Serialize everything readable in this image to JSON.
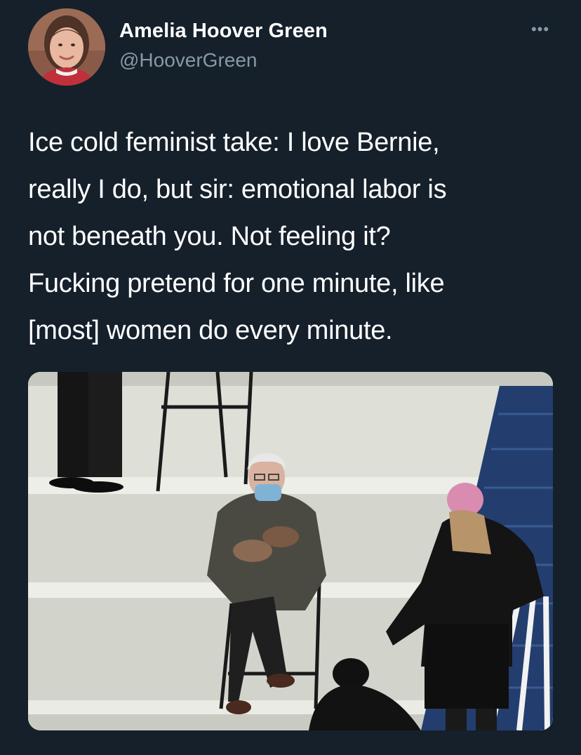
{
  "author": {
    "display_name": "Amelia Hoover Green",
    "handle": "@HooverGreen",
    "avatar_icon": "profile-photo-avatar"
  },
  "menu": {
    "more_label": "•••"
  },
  "tweet": {
    "text": "Ice cold feminist take: I love Bernie,\nreally I do, but sir: emotional labor is\nnot beneath you. Not feeling it?\nFucking pretend for one minute, like\n[most] women do every minute."
  },
  "media": {
    "type": "photo"
  },
  "colors": {
    "background": "#15202b",
    "primary_text": "#ffffff",
    "secondary_text": "#8899a6"
  }
}
